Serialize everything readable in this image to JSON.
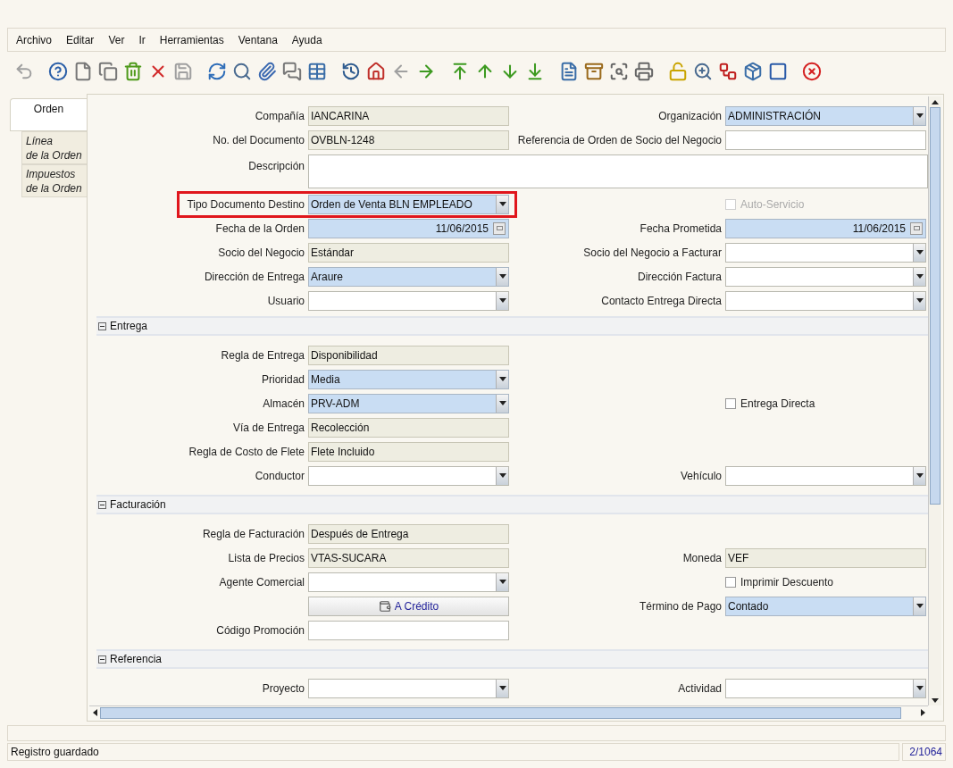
{
  "menu": [
    "Archivo",
    "Editar",
    "Ver",
    "Ir",
    "Herramientas",
    "Ventana",
    "Ayuda"
  ],
  "toolbar": {
    "groups": [
      [
        {
          "kind": "undo",
          "disabled": true
        }
      ],
      [
        {
          "kind": "help",
          "disabled": false
        },
        {
          "kind": "new",
          "disabled": false
        },
        {
          "kind": "copy",
          "disabled": false
        },
        {
          "kind": "delete",
          "disabled": false
        },
        {
          "kind": "delete-selection",
          "disabled": false
        },
        {
          "kind": "save",
          "disabled": true
        }
      ],
      [
        {
          "kind": "refresh",
          "disabled": false
        },
        {
          "kind": "find",
          "disabled": false
        },
        {
          "kind": "attachment",
          "disabled": false
        },
        {
          "kind": "chat",
          "disabled": false
        },
        {
          "kind": "grid",
          "disabled": false
        }
      ],
      [
        {
          "kind": "history",
          "disabled": false
        },
        {
          "kind": "home",
          "disabled": false
        },
        {
          "kind": "previous",
          "disabled": true
        },
        {
          "kind": "next",
          "disabled": false
        }
      ],
      [
        {
          "kind": "first",
          "disabled": false
        },
        {
          "kind": "up",
          "disabled": false
        },
        {
          "kind": "down",
          "disabled": false
        },
        {
          "kind": "last",
          "disabled": false
        }
      ],
      [
        {
          "kind": "report",
          "disabled": false
        },
        {
          "kind": "archive",
          "disabled": false
        },
        {
          "kind": "print-preview",
          "disabled": false
        },
        {
          "kind": "print",
          "disabled": false
        }
      ],
      [
        {
          "kind": "lock",
          "disabled": false
        },
        {
          "kind": "zoom-across",
          "disabled": false
        },
        {
          "kind": "workflow",
          "disabled": false
        },
        {
          "kind": "product-info",
          "disabled": false
        },
        {
          "kind": "window",
          "disabled": false
        }
      ],
      [
        {
          "kind": "close",
          "disabled": false
        }
      ]
    ]
  },
  "tabs": [
    {
      "label": "Orden",
      "selected": true
    },
    {
      "label": "Línea\nde la Orden",
      "selected": false
    },
    {
      "label": "Impuestos\nde la Orden",
      "selected": false
    }
  ],
  "sections": [
    {
      "rows": [
        {
          "left": {
            "label": "Compañía",
            "kind": "readonly",
            "value": "IANCARINA"
          },
          "right": {
            "label": "Organización",
            "kind": "combo",
            "value": "ADMINISTRACIÓN",
            "mandatory": true
          }
        },
        {
          "left": {
            "label": "No. del Documento",
            "kind": "readonly",
            "value": "OVBLN-1248"
          },
          "right": {
            "label": "Referencia de Orden de Socio del Negocio",
            "kind": "text",
            "mandatory": false
          }
        },
        {
          "left": {
            "label": "Descripción",
            "kind": "textarea",
            "mandatory": false
          }
        },
        {
          "left": {
            "label": "Tipo Documento Destino",
            "kind": "combo",
            "value": "Orden de Venta BLN EMPLEADO",
            "mandatory": true,
            "highlighted": true
          },
          "right": {
            "label": "Auto-Servicio",
            "kind": "checkbox",
            "checked": false,
            "disabled": true
          }
        },
        {
          "left": {
            "label": "Fecha de la Orden",
            "kind": "date",
            "value": "11/06/2015",
            "mandatory": true
          },
          "right": {
            "label": "Fecha Prometida",
            "kind": "date",
            "value": "11/06/2015",
            "mandatory": true
          }
        },
        {
          "left": {
            "label": "Socio del Negocio",
            "kind": "readonly",
            "value": "Estándar"
          },
          "right": {
            "label": "Socio del Negocio a Facturar",
            "kind": "combo",
            "mandatory": false
          }
        },
        {
          "left": {
            "label": "Dirección de Entrega",
            "kind": "combo",
            "value": "Araure",
            "mandatory": true
          },
          "right": {
            "label": "Dirección Factura",
            "kind": "combo",
            "mandatory": false
          }
        },
        {
          "left": {
            "label": "Usuario",
            "kind": "combo",
            "mandatory": false
          },
          "right": {
            "label": "Contacto Entrega Directa",
            "kind": "combo",
            "mandatory": false
          }
        }
      ]
    },
    {
      "title": "Entrega",
      "expanded": true,
      "rows": [
        {
          "left": {
            "label": "Regla de Entrega",
            "kind": "readonly",
            "value": "Disponibilidad"
          }
        },
        {
          "left": {
            "label": "Prioridad",
            "kind": "combo",
            "value": "Media",
            "mandatory": true
          }
        },
        {
          "left": {
            "label": "Almacén",
            "kind": "combo",
            "value": "PRV-ADM",
            "mandatory": true
          },
          "right": {
            "label": "Entrega Directa",
            "kind": "checkbox",
            "checked": false,
            "disabled": false
          }
        },
        {
          "left": {
            "label": "Vía de Entrega",
            "kind": "readonly",
            "value": "Recolección"
          }
        },
        {
          "left": {
            "label": "Regla de Costo de Flete",
            "kind": "readonly",
            "value": "Flete Incluido"
          }
        },
        {
          "left": {
            "label": "Conductor",
            "kind": "combo",
            "mandatory": false
          },
          "right": {
            "label": "Vehículo",
            "kind": "combo",
            "mandatory": false
          }
        }
      ]
    },
    {
      "title": "Facturación",
      "expanded": true,
      "rows": [
        {
          "left": {
            "label": "Regla de Facturación",
            "kind": "readonly",
            "value": "Después de Entrega"
          }
        },
        {
          "left": {
            "label": "Lista de Precios",
            "kind": "readonly",
            "value": "VTAS-SUCARA"
          },
          "right": {
            "label": "Moneda",
            "kind": "readonly",
            "value": "VEF"
          }
        },
        {
          "left": {
            "label": "Agente Comercial",
            "kind": "combo",
            "mandatory": false
          },
          "right": {
            "label": "Imprimir Descuento",
            "kind": "checkbox",
            "checked": false,
            "disabled": false
          }
        },
        {
          "left": {
            "label": "A Crédito",
            "kind": "button"
          },
          "right": {
            "label": "Término de Pago",
            "kind": "combo",
            "value": "Contado",
            "mandatory": true
          }
        },
        {
          "left": {
            "label": "Código Promoción",
            "kind": "text",
            "mandatory": false
          }
        }
      ]
    },
    {
      "title": "Referencia",
      "expanded": true,
      "rows": [
        {
          "left": {
            "label": "Proyecto",
            "kind": "combo",
            "mandatory": false
          },
          "right": {
            "label": "Actividad",
            "kind": "combo",
            "mandatory": false
          }
        }
      ]
    }
  ],
  "status": {
    "message": "Registro guardado",
    "record": "2/1064"
  }
}
